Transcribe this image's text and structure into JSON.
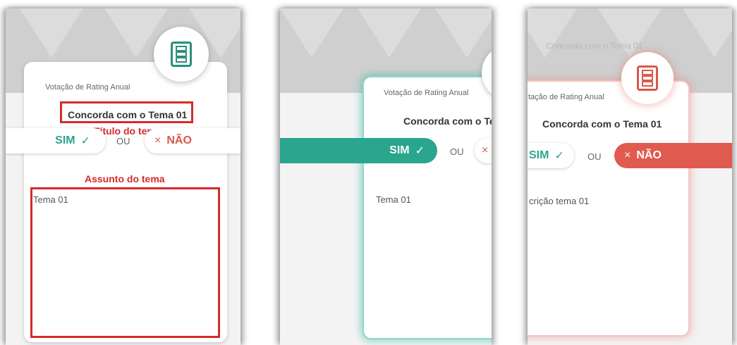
{
  "panel1": {
    "subtitle": "Votação de Rating Anual",
    "title": "Concorda com o Tema 01",
    "annotation_title": "Título do tema",
    "sim_label": "SIM",
    "sim_glyph": "✓",
    "ou_label": "OU",
    "nao_label": "NÃO",
    "nao_glyph": "×",
    "annotation_subject": "Assunto do tema",
    "description": "Tema 01"
  },
  "panel2": {
    "subtitle": "Votação de Rating Anual",
    "title": "Concorda com o Tema",
    "sim_label": "SIM",
    "sim_glyph": "✓",
    "ou_label": "OU",
    "nao_glyph": "×",
    "description": "Tema 01"
  },
  "panel3": {
    "ghost_text": "Concorda com o Tema 01",
    "subtitle": "tação de Rating Anual",
    "title": "Concorda com o Tema 01",
    "sim_label": "SIM",
    "sim_glyph": "✓",
    "ou_label": "OU",
    "nao_label": "NÃO",
    "nao_glyph": "×",
    "description": "crição tema 01"
  },
  "colors": {
    "accent_green": "#2aa58e",
    "accent_red": "#e05a4f",
    "annotation_red": "#d42b2b"
  },
  "icons": [
    "document-list-icon",
    "check-icon",
    "close-icon"
  ]
}
